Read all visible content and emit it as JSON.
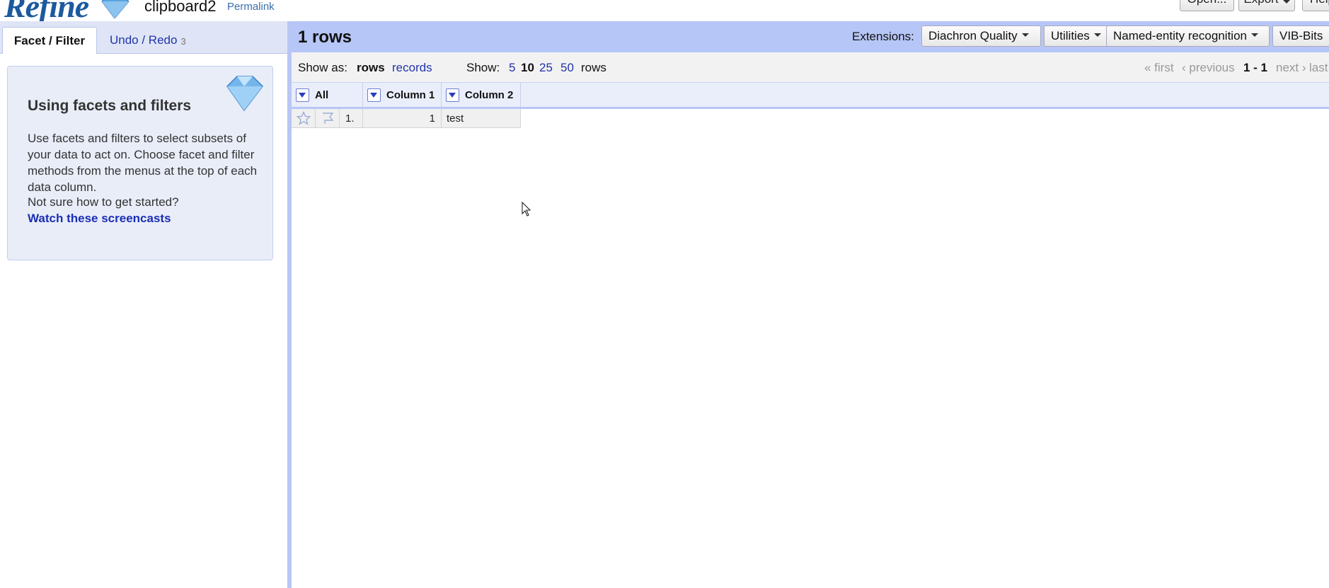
{
  "header": {
    "logo_text": "Refine",
    "project_name": "clipboard2",
    "permalink": "Permalink",
    "buttons": {
      "open": "Open...",
      "export": "Export",
      "help": "Help"
    }
  },
  "left_panel": {
    "tabs": [
      {
        "label": "Facet / Filter",
        "active": true
      },
      {
        "label": "Undo / Redo",
        "count": "3",
        "active": false
      }
    ],
    "help": {
      "title": "Using facets and filters",
      "body": "Use facets and filters to select subsets of your data to act on. Choose facet and filter methods from the menus at the top of each data column.",
      "question": "Not sure how to get started?",
      "link": "Watch these screencasts"
    }
  },
  "summary": {
    "row_count": "1 rows",
    "extensions_label": "Extensions:",
    "extensions": [
      "Diachron Quality",
      "Utilities",
      "Named-entity recognition",
      "VIB-Bits"
    ]
  },
  "view": {
    "show_as_label": "Show as:",
    "show_as_rows": "rows",
    "show_as_records": "records",
    "show_label": "Show:",
    "page_sizes": [
      "5",
      "10",
      "25",
      "50"
    ],
    "selected_page_size": "10",
    "rows_suffix": "rows",
    "pager": {
      "first": "« first",
      "previous": "‹ previous",
      "range": "1 - 1",
      "next": "next ›",
      "last": "last »"
    }
  },
  "grid": {
    "columns": [
      "All",
      "Column 1",
      "Column 2"
    ],
    "rows": [
      {
        "index": "1.",
        "values": [
          "1",
          "test"
        ]
      }
    ]
  },
  "colors": {
    "summary_bar": "#b6c6f6",
    "divider": "#b9c6f5",
    "link": "#2233aa",
    "logo": "#1c5a9e"
  }
}
